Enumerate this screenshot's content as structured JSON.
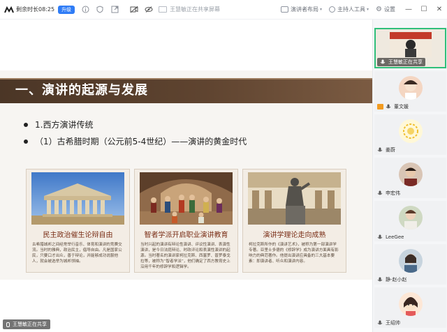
{
  "toolbar": {
    "time_left": "剩余时长08:25",
    "upgrade": "升级",
    "sharing_status": "王慧敏正在共享屏幕",
    "speaker_layout": "演讲者布局",
    "host_tools": "主持人工具",
    "settings": "设置",
    "icons": [
      "meeting-logo",
      "info-icon",
      "shield-icon",
      "expand-icon",
      "mute-video-icon",
      "eye-icon",
      "speaker-layout-icon",
      "host-tools-icon",
      "settings-icon"
    ]
  },
  "slide": {
    "title": "一、演讲的起源与发展",
    "bullet_1": "1.西方演讲传统",
    "bullet_2": "（1）古希腊时期（公元前5-4世纪）——演讲的黄金时代",
    "cards": [
      {
        "heading": "民主政治催生论辩自由",
        "desc": "古希腊城邦之间经常举行音乐、体育和演讲的竞赛交流。当时的雅典，政治民主，倡导自由。凡是国家公民，只要口才出众，善于辩论，并能够成功说服他人，就会被选举为城邦领袖。"
      },
      {
        "heading": "智者学派开启职业演讲教育",
        "desc": "当时兴起的演讲有辩论性演讲、评议性演讲、表演性演讲，是今日法庭辩论、时政评论和表演性演讲的起源。当时著名的演讲家柯拉克斯、西塞罗、普罗泰戈拉等，被称为“智者学派”，他们确定了西方教育史上沿用千年的修辞学和逻辑学。"
      },
      {
        "heading": "演讲学理论走向成熟",
        "desc": "柯拉克斯所作的《演讲艺术》，被称为第一部演讲学专著。亚里士多德的《修辞学》成为演讲方面具有影响力的典范著作。他提出演讲应具备的三大基本要素：即演讲者、听众和演讲内容。"
      }
    ]
  },
  "share_badge": "王慧敏正在共享",
  "participants": [
    {
      "name": "王慧敏正在共享",
      "active": true
    },
    {
      "name": "董文媛",
      "host": true
    },
    {
      "name": "姜蔚"
    },
    {
      "name": "申宏伟"
    },
    {
      "name": "LeeGee"
    },
    {
      "name": "静-赵小赵"
    },
    {
      "name": "王绍帅"
    }
  ],
  "colors": {
    "accent_green": "#2fbf7a",
    "upgrade_blue": "#2f7cf6",
    "slide_band": "#5f4430",
    "card_heading": "#7a2e16"
  }
}
